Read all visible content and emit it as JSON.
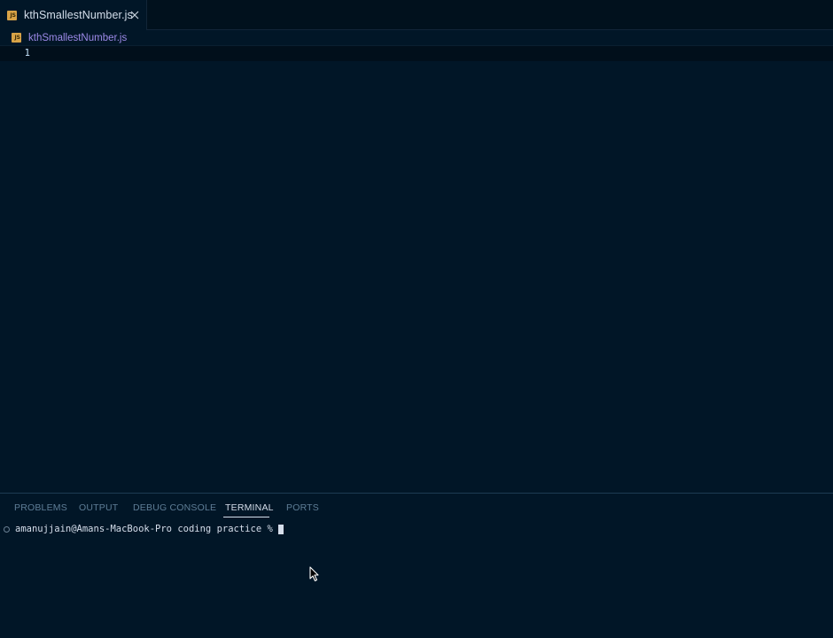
{
  "tab": {
    "icon_name": "javascript-file-icon",
    "icon_text": "JS",
    "label": "kthSmallestNumber.js",
    "close_icon": "close-icon"
  },
  "breadcrumb": {
    "icon_name": "javascript-file-icon",
    "icon_text": "JS",
    "label": "kthSmallestNumber.js"
  },
  "editor": {
    "lines": [
      {
        "number": "1",
        "text": ""
      }
    ]
  },
  "panel": {
    "tabs": [
      {
        "label": "PROBLEMS",
        "active": false
      },
      {
        "label": "OUTPUT",
        "active": false
      },
      {
        "label": "DEBUG CONSOLE",
        "active": false
      },
      {
        "label": "TERMINAL",
        "active": true
      },
      {
        "label": "PORTS",
        "active": false
      }
    ]
  },
  "terminal": {
    "prompt": "amanujjain@Amans-MacBook-Pro coding practice % "
  },
  "colors": {
    "background": "#011627",
    "tab_bar": "#01111d",
    "js_icon": "#d8a347",
    "breadcrumb_text": "#9d8ae8",
    "foreground": "#d6deeb",
    "inactive_panel_tab": "#5f7e97"
  }
}
